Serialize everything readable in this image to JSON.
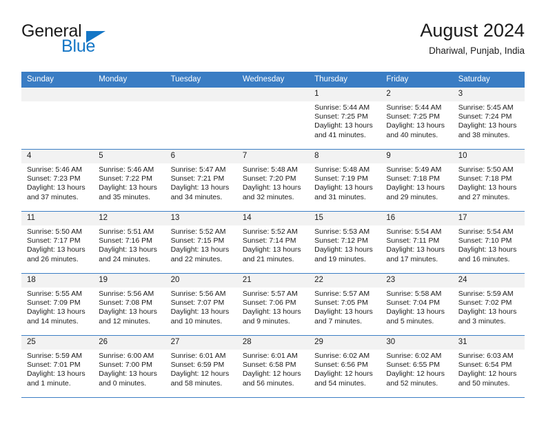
{
  "brand": {
    "name_top": "General",
    "name_bottom": "Blue",
    "accent_color": "#1476c6"
  },
  "header": {
    "title": "August 2024",
    "subtitle": "Dhariwal, Punjab, India"
  },
  "calendar": {
    "header_bg": "#3a7dc4",
    "daynum_bg": "#f2f2f2",
    "weekday_headers": [
      "Sunday",
      "Monday",
      "Tuesday",
      "Wednesday",
      "Thursday",
      "Friday",
      "Saturday"
    ],
    "weeks": [
      [
        {
          "day": "",
          "sunrise": "",
          "sunset": "",
          "daylight1": "",
          "daylight2": ""
        },
        {
          "day": "",
          "sunrise": "",
          "sunset": "",
          "daylight1": "",
          "daylight2": ""
        },
        {
          "day": "",
          "sunrise": "",
          "sunset": "",
          "daylight1": "",
          "daylight2": ""
        },
        {
          "day": "",
          "sunrise": "",
          "sunset": "",
          "daylight1": "",
          "daylight2": ""
        },
        {
          "day": "1",
          "sunrise": "Sunrise: 5:44 AM",
          "sunset": "Sunset: 7:25 PM",
          "daylight1": "Daylight: 13 hours",
          "daylight2": "and 41 minutes."
        },
        {
          "day": "2",
          "sunrise": "Sunrise: 5:44 AM",
          "sunset": "Sunset: 7:25 PM",
          "daylight1": "Daylight: 13 hours",
          "daylight2": "and 40 minutes."
        },
        {
          "day": "3",
          "sunrise": "Sunrise: 5:45 AM",
          "sunset": "Sunset: 7:24 PM",
          "daylight1": "Daylight: 13 hours",
          "daylight2": "and 38 minutes."
        }
      ],
      [
        {
          "day": "4",
          "sunrise": "Sunrise: 5:46 AM",
          "sunset": "Sunset: 7:23 PM",
          "daylight1": "Daylight: 13 hours",
          "daylight2": "and 37 minutes."
        },
        {
          "day": "5",
          "sunrise": "Sunrise: 5:46 AM",
          "sunset": "Sunset: 7:22 PM",
          "daylight1": "Daylight: 13 hours",
          "daylight2": "and 35 minutes."
        },
        {
          "day": "6",
          "sunrise": "Sunrise: 5:47 AM",
          "sunset": "Sunset: 7:21 PM",
          "daylight1": "Daylight: 13 hours",
          "daylight2": "and 34 minutes."
        },
        {
          "day": "7",
          "sunrise": "Sunrise: 5:48 AM",
          "sunset": "Sunset: 7:20 PM",
          "daylight1": "Daylight: 13 hours",
          "daylight2": "and 32 minutes."
        },
        {
          "day": "8",
          "sunrise": "Sunrise: 5:48 AM",
          "sunset": "Sunset: 7:19 PM",
          "daylight1": "Daylight: 13 hours",
          "daylight2": "and 31 minutes."
        },
        {
          "day": "9",
          "sunrise": "Sunrise: 5:49 AM",
          "sunset": "Sunset: 7:18 PM",
          "daylight1": "Daylight: 13 hours",
          "daylight2": "and 29 minutes."
        },
        {
          "day": "10",
          "sunrise": "Sunrise: 5:50 AM",
          "sunset": "Sunset: 7:18 PM",
          "daylight1": "Daylight: 13 hours",
          "daylight2": "and 27 minutes."
        }
      ],
      [
        {
          "day": "11",
          "sunrise": "Sunrise: 5:50 AM",
          "sunset": "Sunset: 7:17 PM",
          "daylight1": "Daylight: 13 hours",
          "daylight2": "and 26 minutes."
        },
        {
          "day": "12",
          "sunrise": "Sunrise: 5:51 AM",
          "sunset": "Sunset: 7:16 PM",
          "daylight1": "Daylight: 13 hours",
          "daylight2": "and 24 minutes."
        },
        {
          "day": "13",
          "sunrise": "Sunrise: 5:52 AM",
          "sunset": "Sunset: 7:15 PM",
          "daylight1": "Daylight: 13 hours",
          "daylight2": "and 22 minutes."
        },
        {
          "day": "14",
          "sunrise": "Sunrise: 5:52 AM",
          "sunset": "Sunset: 7:14 PM",
          "daylight1": "Daylight: 13 hours",
          "daylight2": "and 21 minutes."
        },
        {
          "day": "15",
          "sunrise": "Sunrise: 5:53 AM",
          "sunset": "Sunset: 7:12 PM",
          "daylight1": "Daylight: 13 hours",
          "daylight2": "and 19 minutes."
        },
        {
          "day": "16",
          "sunrise": "Sunrise: 5:54 AM",
          "sunset": "Sunset: 7:11 PM",
          "daylight1": "Daylight: 13 hours",
          "daylight2": "and 17 minutes."
        },
        {
          "day": "17",
          "sunrise": "Sunrise: 5:54 AM",
          "sunset": "Sunset: 7:10 PM",
          "daylight1": "Daylight: 13 hours",
          "daylight2": "and 16 minutes."
        }
      ],
      [
        {
          "day": "18",
          "sunrise": "Sunrise: 5:55 AM",
          "sunset": "Sunset: 7:09 PM",
          "daylight1": "Daylight: 13 hours",
          "daylight2": "and 14 minutes."
        },
        {
          "day": "19",
          "sunrise": "Sunrise: 5:56 AM",
          "sunset": "Sunset: 7:08 PM",
          "daylight1": "Daylight: 13 hours",
          "daylight2": "and 12 minutes."
        },
        {
          "day": "20",
          "sunrise": "Sunrise: 5:56 AM",
          "sunset": "Sunset: 7:07 PM",
          "daylight1": "Daylight: 13 hours",
          "daylight2": "and 10 minutes."
        },
        {
          "day": "21",
          "sunrise": "Sunrise: 5:57 AM",
          "sunset": "Sunset: 7:06 PM",
          "daylight1": "Daylight: 13 hours",
          "daylight2": "and 9 minutes."
        },
        {
          "day": "22",
          "sunrise": "Sunrise: 5:57 AM",
          "sunset": "Sunset: 7:05 PM",
          "daylight1": "Daylight: 13 hours",
          "daylight2": "and 7 minutes."
        },
        {
          "day": "23",
          "sunrise": "Sunrise: 5:58 AM",
          "sunset": "Sunset: 7:04 PM",
          "daylight1": "Daylight: 13 hours",
          "daylight2": "and 5 minutes."
        },
        {
          "day": "24",
          "sunrise": "Sunrise: 5:59 AM",
          "sunset": "Sunset: 7:02 PM",
          "daylight1": "Daylight: 13 hours",
          "daylight2": "and 3 minutes."
        }
      ],
      [
        {
          "day": "25",
          "sunrise": "Sunrise: 5:59 AM",
          "sunset": "Sunset: 7:01 PM",
          "daylight1": "Daylight: 13 hours",
          "daylight2": "and 1 minute."
        },
        {
          "day": "26",
          "sunrise": "Sunrise: 6:00 AM",
          "sunset": "Sunset: 7:00 PM",
          "daylight1": "Daylight: 13 hours",
          "daylight2": "and 0 minutes."
        },
        {
          "day": "27",
          "sunrise": "Sunrise: 6:01 AM",
          "sunset": "Sunset: 6:59 PM",
          "daylight1": "Daylight: 12 hours",
          "daylight2": "and 58 minutes."
        },
        {
          "day": "28",
          "sunrise": "Sunrise: 6:01 AM",
          "sunset": "Sunset: 6:58 PM",
          "daylight1": "Daylight: 12 hours",
          "daylight2": "and 56 minutes."
        },
        {
          "day": "29",
          "sunrise": "Sunrise: 6:02 AM",
          "sunset": "Sunset: 6:56 PM",
          "daylight1": "Daylight: 12 hours",
          "daylight2": "and 54 minutes."
        },
        {
          "day": "30",
          "sunrise": "Sunrise: 6:02 AM",
          "sunset": "Sunset: 6:55 PM",
          "daylight1": "Daylight: 12 hours",
          "daylight2": "and 52 minutes."
        },
        {
          "day": "31",
          "sunrise": "Sunrise: 6:03 AM",
          "sunset": "Sunset: 6:54 PM",
          "daylight1": "Daylight: 12 hours",
          "daylight2": "and 50 minutes."
        }
      ]
    ]
  }
}
